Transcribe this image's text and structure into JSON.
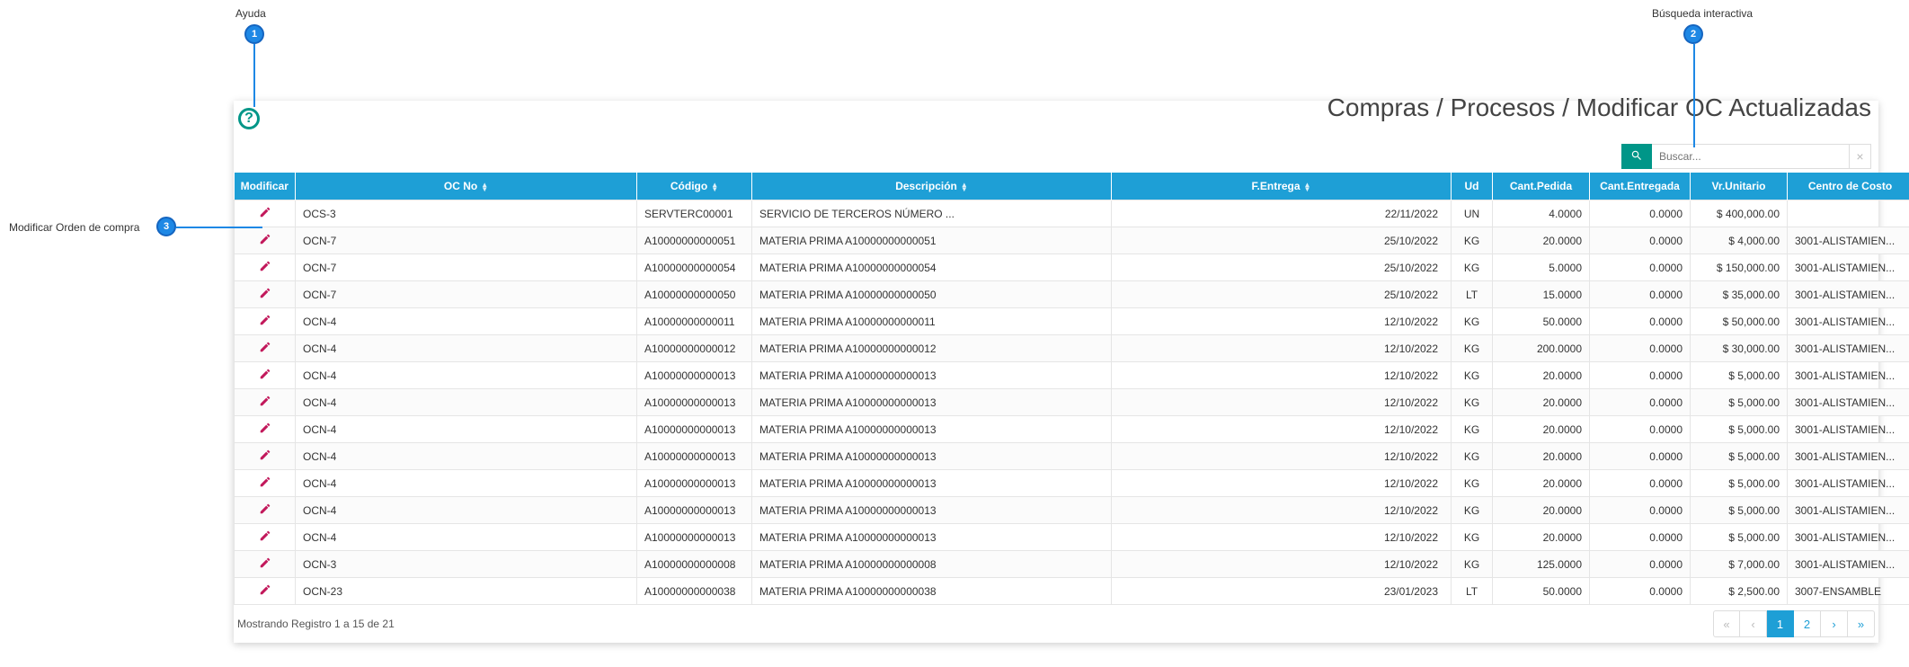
{
  "callouts": {
    "c1": {
      "label": "Ayuda",
      "num": "1"
    },
    "c2": {
      "label": "Búsqueda interactiva",
      "num": "2"
    },
    "c3": {
      "label": "Modificar Orden de compra",
      "num": "3"
    }
  },
  "header": {
    "breadcrumb": "Compras / Procesos / Modificar OC Actualizadas"
  },
  "search": {
    "placeholder": "Buscar..."
  },
  "columns": {
    "modificar": "Modificar",
    "ocno": "OC No",
    "codigo": "Código",
    "descripcion": "Descripción",
    "fentrega": "F.Entrega",
    "ud": "Ud",
    "cantpedida": "Cant.Pedida",
    "cantentregada": "Cant.Entregada",
    "vrunitario": "Vr.Unitario",
    "centrocosto": "Centro de Costo"
  },
  "rows": [
    {
      "ocno": "OCS-3",
      "codigo": "SERVTERC00001",
      "desc": "SERVICIO DE TERCEROS NÚMERO ...",
      "fecha": "22/11/2022",
      "ud": "UN",
      "cantp": "4.0000",
      "cante": "0.0000",
      "vr": "$ 400,000.00",
      "cc": ""
    },
    {
      "ocno": "OCN-7",
      "codigo": "A10000000000051",
      "desc": "MATERIA PRIMA A10000000000051",
      "fecha": "25/10/2022",
      "ud": "KG",
      "cantp": "20.0000",
      "cante": "0.0000",
      "vr": "$ 4,000.00",
      "cc": "3001-ALISTAMIEN..."
    },
    {
      "ocno": "OCN-7",
      "codigo": "A10000000000054",
      "desc": "MATERIA PRIMA A10000000000054",
      "fecha": "25/10/2022",
      "ud": "KG",
      "cantp": "5.0000",
      "cante": "0.0000",
      "vr": "$ 150,000.00",
      "cc": "3001-ALISTAMIEN..."
    },
    {
      "ocno": "OCN-7",
      "codigo": "A10000000000050",
      "desc": "MATERIA PRIMA A10000000000050",
      "fecha": "25/10/2022",
      "ud": "LT",
      "cantp": "15.0000",
      "cante": "0.0000",
      "vr": "$ 35,000.00",
      "cc": "3001-ALISTAMIEN..."
    },
    {
      "ocno": "OCN-4",
      "codigo": "A10000000000011",
      "desc": "MATERIA PRIMA A10000000000011",
      "fecha": "12/10/2022",
      "ud": "KG",
      "cantp": "50.0000",
      "cante": "0.0000",
      "vr": "$ 50,000.00",
      "cc": "3001-ALISTAMIEN..."
    },
    {
      "ocno": "OCN-4",
      "codigo": "A10000000000012",
      "desc": "MATERIA PRIMA A10000000000012",
      "fecha": "12/10/2022",
      "ud": "KG",
      "cantp": "200.0000",
      "cante": "0.0000",
      "vr": "$ 30,000.00",
      "cc": "3001-ALISTAMIEN..."
    },
    {
      "ocno": "OCN-4",
      "codigo": "A10000000000013",
      "desc": "MATERIA PRIMA A10000000000013",
      "fecha": "12/10/2022",
      "ud": "KG",
      "cantp": "20.0000",
      "cante": "0.0000",
      "vr": "$ 5,000.00",
      "cc": "3001-ALISTAMIEN..."
    },
    {
      "ocno": "OCN-4",
      "codigo": "A10000000000013",
      "desc": "MATERIA PRIMA A10000000000013",
      "fecha": "12/10/2022",
      "ud": "KG",
      "cantp": "20.0000",
      "cante": "0.0000",
      "vr": "$ 5,000.00",
      "cc": "3001-ALISTAMIEN..."
    },
    {
      "ocno": "OCN-4",
      "codigo": "A10000000000013",
      "desc": "MATERIA PRIMA A10000000000013",
      "fecha": "12/10/2022",
      "ud": "KG",
      "cantp": "20.0000",
      "cante": "0.0000",
      "vr": "$ 5,000.00",
      "cc": "3001-ALISTAMIEN..."
    },
    {
      "ocno": "OCN-4",
      "codigo": "A10000000000013",
      "desc": "MATERIA PRIMA A10000000000013",
      "fecha": "12/10/2022",
      "ud": "KG",
      "cantp": "20.0000",
      "cante": "0.0000",
      "vr": "$ 5,000.00",
      "cc": "3001-ALISTAMIEN..."
    },
    {
      "ocno": "OCN-4",
      "codigo": "A10000000000013",
      "desc": "MATERIA PRIMA A10000000000013",
      "fecha": "12/10/2022",
      "ud": "KG",
      "cantp": "20.0000",
      "cante": "0.0000",
      "vr": "$ 5,000.00",
      "cc": "3001-ALISTAMIEN..."
    },
    {
      "ocno": "OCN-4",
      "codigo": "A10000000000013",
      "desc": "MATERIA PRIMA A10000000000013",
      "fecha": "12/10/2022",
      "ud": "KG",
      "cantp": "20.0000",
      "cante": "0.0000",
      "vr": "$ 5,000.00",
      "cc": "3001-ALISTAMIEN..."
    },
    {
      "ocno": "OCN-4",
      "codigo": "A10000000000013",
      "desc": "MATERIA PRIMA A10000000000013",
      "fecha": "12/10/2022",
      "ud": "KG",
      "cantp": "20.0000",
      "cante": "0.0000",
      "vr": "$ 5,000.00",
      "cc": "3001-ALISTAMIEN..."
    },
    {
      "ocno": "OCN-3",
      "codigo": "A10000000000008",
      "desc": "MATERIA PRIMA A10000000000008",
      "fecha": "12/10/2022",
      "ud": "KG",
      "cantp": "125.0000",
      "cante": "0.0000",
      "vr": "$ 7,000.00",
      "cc": "3001-ALISTAMIEN..."
    },
    {
      "ocno": "OCN-23",
      "codigo": "A10000000000038",
      "desc": "MATERIA PRIMA A10000000000038",
      "fecha": "23/01/2023",
      "ud": "LT",
      "cantp": "50.0000",
      "cante": "0.0000",
      "vr": "$ 2,500.00",
      "cc": "3007-ENSAMBLE"
    }
  ],
  "footer": {
    "info": "Mostrando Registro 1 a 15 de 21",
    "pages": {
      "first": "«",
      "prev": "‹",
      "p1": "1",
      "p2": "2",
      "next": "›",
      "last": "»"
    }
  }
}
